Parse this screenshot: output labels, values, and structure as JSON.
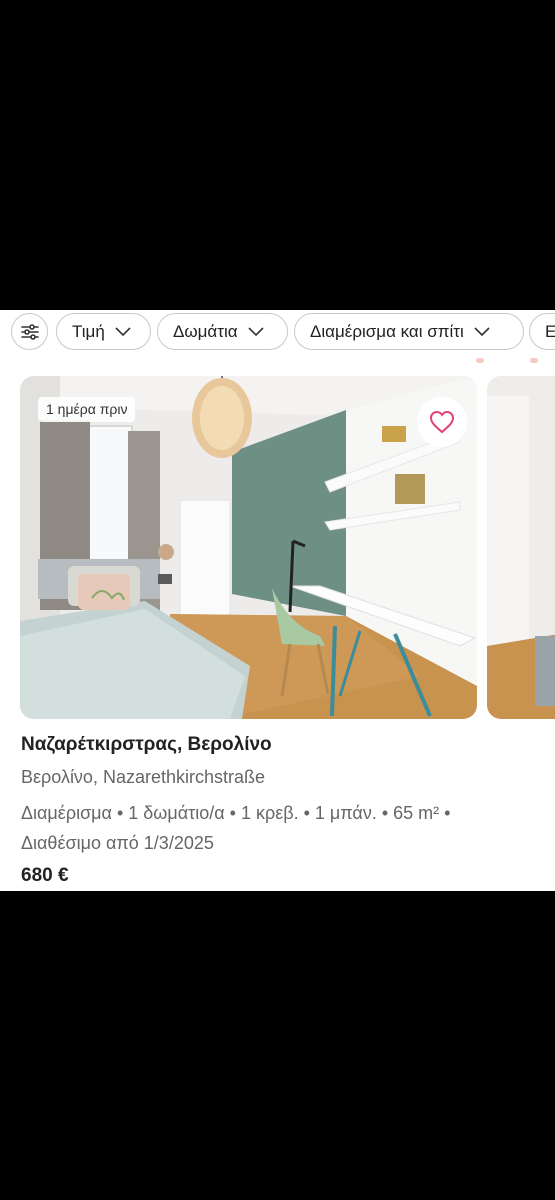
{
  "filters": {
    "settings_icon": "sliders-icon",
    "chips": [
      {
        "label": "Τιμή"
      },
      {
        "label": "Δωμάτια"
      },
      {
        "label": "Διαμέρισμα και σπίτι"
      },
      {
        "label": "Ε"
      }
    ]
  },
  "listing": {
    "posted_badge": "1 ημέρα πριν",
    "title": "Ναζαρέτκιρστρας, Βερολίνο",
    "location": "Βερολίνο, Nazarethkirchstraße",
    "details_line1": "Διαμέρισμα • 1 δωμάτιο/α • 1 κρεβ. • 1 μπάν. • 65 m² •",
    "details_line2": "Διαθέσιμο από 1/3/2025",
    "price": "680 €"
  },
  "colors": {
    "heart": "#e0417a",
    "accent_wall": "#6e8f84",
    "floor": "#c8924f"
  }
}
